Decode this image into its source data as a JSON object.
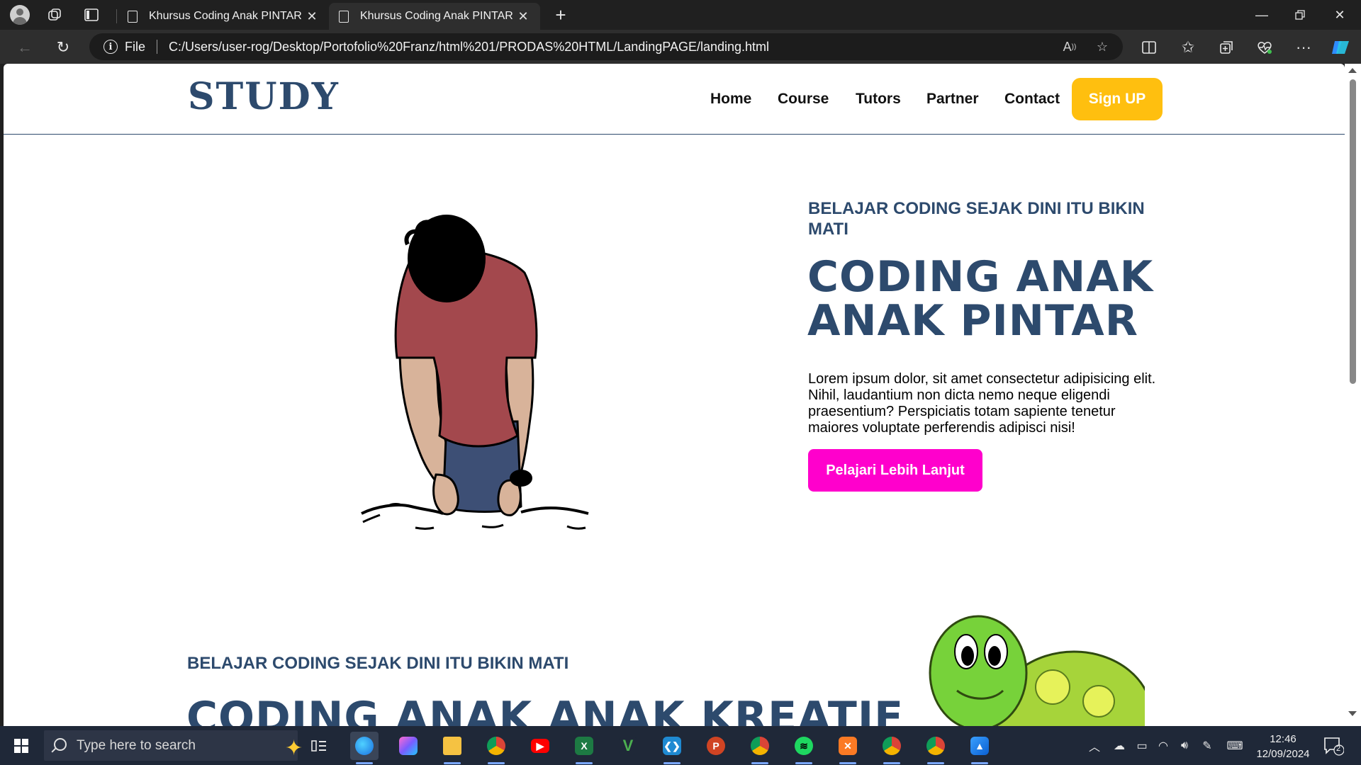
{
  "browser": {
    "tabs": [
      {
        "title": "Khursus Coding Anak PINTAR",
        "active": false
      },
      {
        "title": "Khursus Coding Anak PINTAR",
        "active": true
      }
    ],
    "address": {
      "scheme_label": "File",
      "url": "C:/Users/user-rog/Desktop/Portofolio%20Franz/html%201/PRODAS%20HTML/LandingPAGE/landing.html"
    }
  },
  "site": {
    "logo": "STUDY",
    "nav": [
      "Home",
      "Course",
      "Tutors",
      "Partner",
      "Contact"
    ],
    "signup_label": "Sign UP",
    "hero": {
      "subtitle": "BELAJAR CODING SEJAK DINI ITU BIKIN MATI",
      "title": "CODING ANAK ANAK PINTAR",
      "body": "Lorem ipsum dolor, sit amet consectetur adipisicing elit. Nihil, laudantium non dicta nemo neque eligendi praesentium? Perspiciatis totam sapiente tenetur maiores voluptate perferendis adipisci nisi!",
      "cta_label": "Pelajari Lebih Lanjut"
    },
    "section2": {
      "subtitle": "BELAJAR CODING SEJAK DINI ITU BIKIN MATI",
      "title": "CODING ANAK ANAK KREATIF"
    },
    "colors": {
      "primary": "#2d4a6d",
      "signup": "#ffbf0f",
      "cta": "#ff00cc"
    }
  },
  "taskbar": {
    "search_placeholder": "Type here to search",
    "apps": [
      "task-view-icon",
      "edge-icon",
      "copilot-icon",
      "file-explorer-icon",
      "chrome-icon",
      "youtube-icon",
      "excel-icon",
      "vim-icon",
      "vscode-icon",
      "powerpoint-icon",
      "chrome-profile-f-icon",
      "spotify-icon",
      "xampp-icon",
      "chrome-profile-n-icon",
      "chrome-profile-f2-icon",
      "photos-icon"
    ],
    "time": "12:46",
    "date": "12/09/2024",
    "notification_count": "2"
  }
}
